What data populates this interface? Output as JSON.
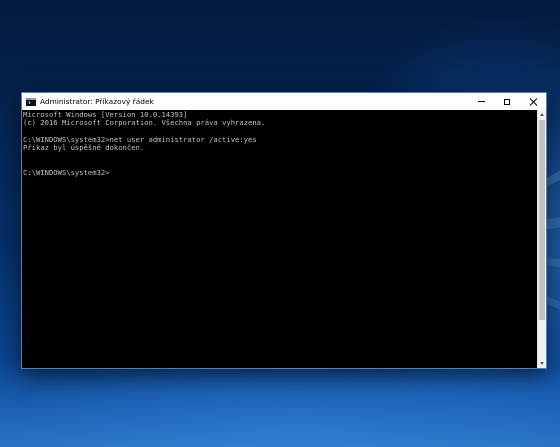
{
  "window": {
    "title": "Administrator: Příkazový řádek",
    "icon": "cmd-icon"
  },
  "controls": {
    "minimize": "minimize-icon",
    "maximize": "maximize-icon",
    "close": "close-icon"
  },
  "console": {
    "lines": [
      "Microsoft Windows [Version 10.0.14393]",
      "(c) 2016 Microsoft Corporation. Všechna práva vyhrazena.",
      "",
      "C:\\WINDOWS\\system32>net user administrator /active:yes",
      "Příkaz byl úspěšně dokončen.",
      "",
      "",
      "C:\\WINDOWS\\system32>"
    ],
    "text_color": "#c0c0c0",
    "background": "#000000"
  }
}
